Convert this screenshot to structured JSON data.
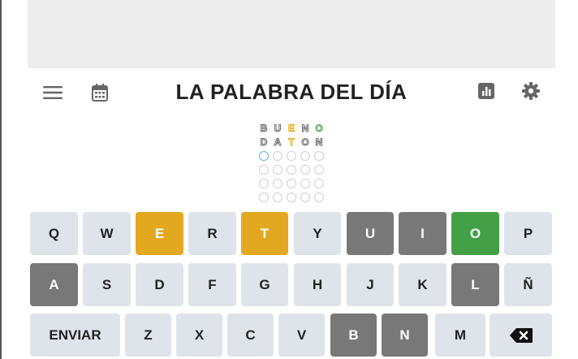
{
  "header": {
    "title": "LA PALABRA DEL DÍA",
    "icons": [
      "menu-icon",
      "calendar-icon",
      "stats-icon",
      "gear-icon"
    ]
  },
  "board": {
    "rows": [
      [
        {
          "letter": "B",
          "state": "absent"
        },
        {
          "letter": "U",
          "state": "absent"
        },
        {
          "letter": "E",
          "state": "present"
        },
        {
          "letter": "N",
          "state": "absent"
        },
        {
          "letter": "O",
          "state": "correct"
        }
      ],
      [
        {
          "letter": "D",
          "state": "absent"
        },
        {
          "letter": "A",
          "state": "absent"
        },
        {
          "letter": "T",
          "state": "present"
        },
        {
          "letter": "O",
          "state": "absent"
        },
        {
          "letter": "N",
          "state": "absent"
        }
      ]
    ],
    "empty_rows": 4,
    "columns": 5
  },
  "keyboard": {
    "row1": [
      {
        "label": "Q",
        "state": "default"
      },
      {
        "label": "W",
        "state": "default"
      },
      {
        "label": "E",
        "state": "present"
      },
      {
        "label": "R",
        "state": "default"
      },
      {
        "label": "T",
        "state": "present"
      },
      {
        "label": "Y",
        "state": "default"
      },
      {
        "label": "U",
        "state": "absent"
      },
      {
        "label": "I",
        "state": "absent"
      },
      {
        "label": "O",
        "state": "correct"
      },
      {
        "label": "P",
        "state": "default"
      }
    ],
    "row2": [
      {
        "label": "A",
        "state": "absent"
      },
      {
        "label": "S",
        "state": "default"
      },
      {
        "label": "D",
        "state": "default"
      },
      {
        "label": "F",
        "state": "default"
      },
      {
        "label": "G",
        "state": "default"
      },
      {
        "label": "H",
        "state": "default"
      },
      {
        "label": "J",
        "state": "default"
      },
      {
        "label": "K",
        "state": "default"
      },
      {
        "label": "L",
        "state": "absent"
      },
      {
        "label": "Ñ",
        "state": "default"
      }
    ],
    "row3": [
      {
        "label": "ENVIAR",
        "state": "default"
      },
      {
        "label": "Z",
        "state": "default"
      },
      {
        "label": "X",
        "state": "default"
      },
      {
        "label": "C",
        "state": "default"
      },
      {
        "label": "V",
        "state": "default"
      },
      {
        "label": "B",
        "state": "absent"
      },
      {
        "label": "N",
        "state": "absent"
      },
      {
        "label": "M",
        "state": "default"
      },
      {
        "label": "",
        "state": "default",
        "icon": "backspace-icon"
      }
    ]
  },
  "colors": {
    "absent": "#787878",
    "present": "#e2a820",
    "correct": "#43a047",
    "key_default": "#dfe4eb"
  }
}
